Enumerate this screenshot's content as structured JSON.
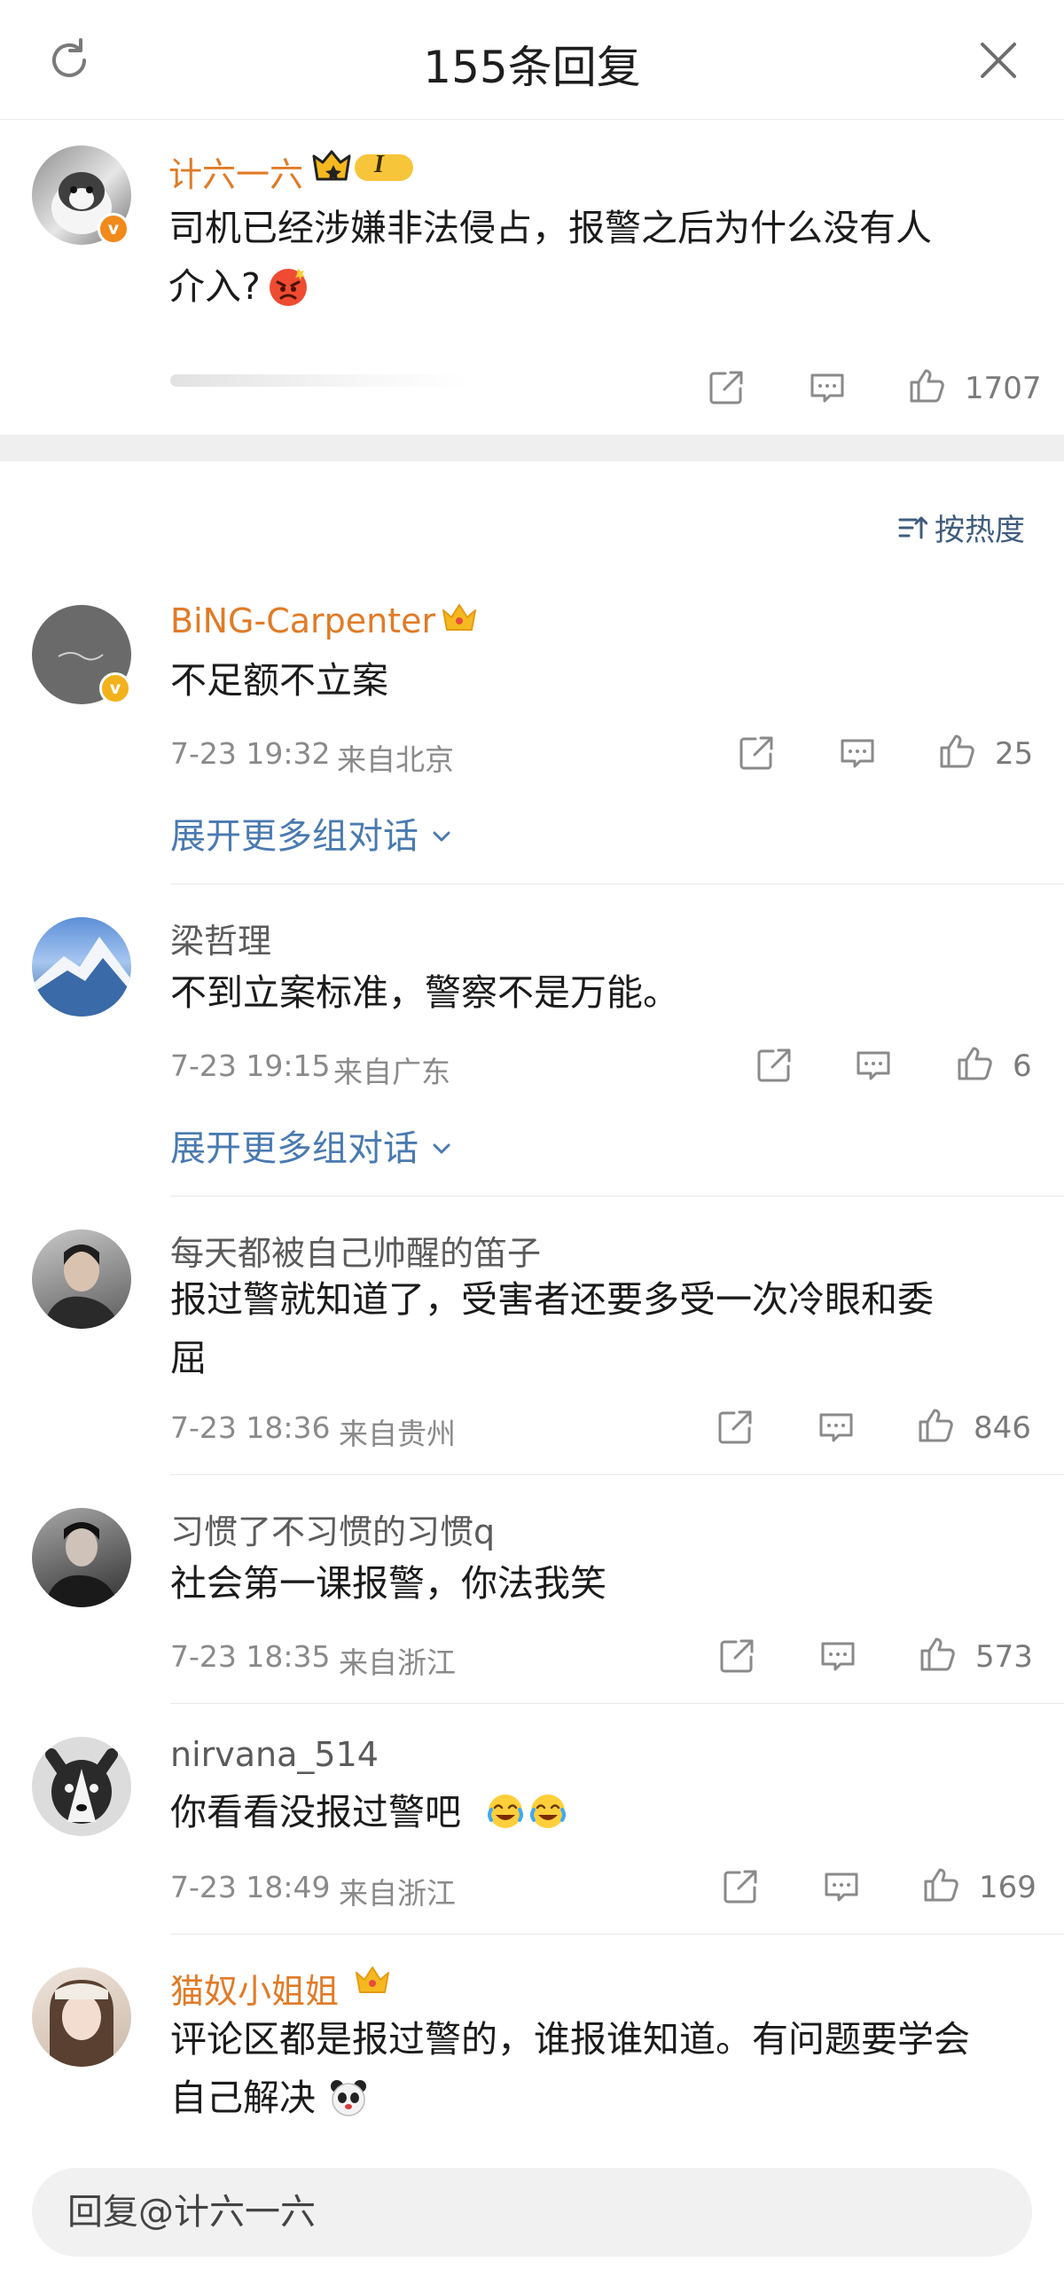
{
  "header": {
    "title": "155条回复"
  },
  "main_comment": {
    "username": "计六一六",
    "rank_badge": "I",
    "text_line1": "司机已经涉嫌非法侵占，报警之后为什么没有人",
    "text_line2": "介入?",
    "likes": "1707"
  },
  "sort": {
    "label": "按热度"
  },
  "replies": [
    {
      "username": "BiNG-Carpenter",
      "text1": "不足额不立案",
      "text2": "",
      "time": "7-23 19:32",
      "location": "来自北京",
      "likes": "25",
      "expand": "展开更多组对话"
    },
    {
      "username": "梁哲理",
      "text1": "不到立案标准，警察不是万能。",
      "text2": "",
      "time": "7-23 19:15",
      "location": "来自广东",
      "likes": "6",
      "expand": "展开更多组对话"
    },
    {
      "username": "每天都被自己帅醒的笛子",
      "text1": "报过警就知道了，受害者还要多受一次冷眼和委",
      "text2": "屈",
      "time": "7-23 18:36",
      "location": "来自贵州",
      "likes": "846"
    },
    {
      "username": "习惯了不习惯的习惯q",
      "text1": "社会第一课报警，你法我笑",
      "text2": "",
      "time": "7-23 18:35",
      "location": "来自浙江",
      "likes": "573"
    },
    {
      "username": "nirvana_514",
      "text1": "你看看没报过警吧",
      "text2": "",
      "time": "7-23 18:49",
      "location": "来自浙江",
      "likes": "169"
    },
    {
      "username": "猫奴小姐姐",
      "text1": "评论区都是报过警的，谁报谁知道。有问题要学会",
      "text2": "自己解决",
      "time": "",
      "location": "",
      "likes": ""
    }
  ],
  "footer": {
    "reply_placeholder": "回复@计六一六"
  },
  "colors": {
    "accent_orange": "#e07b27",
    "link_blue": "#4a7ab0",
    "vip_gold": "#f2b21c"
  }
}
